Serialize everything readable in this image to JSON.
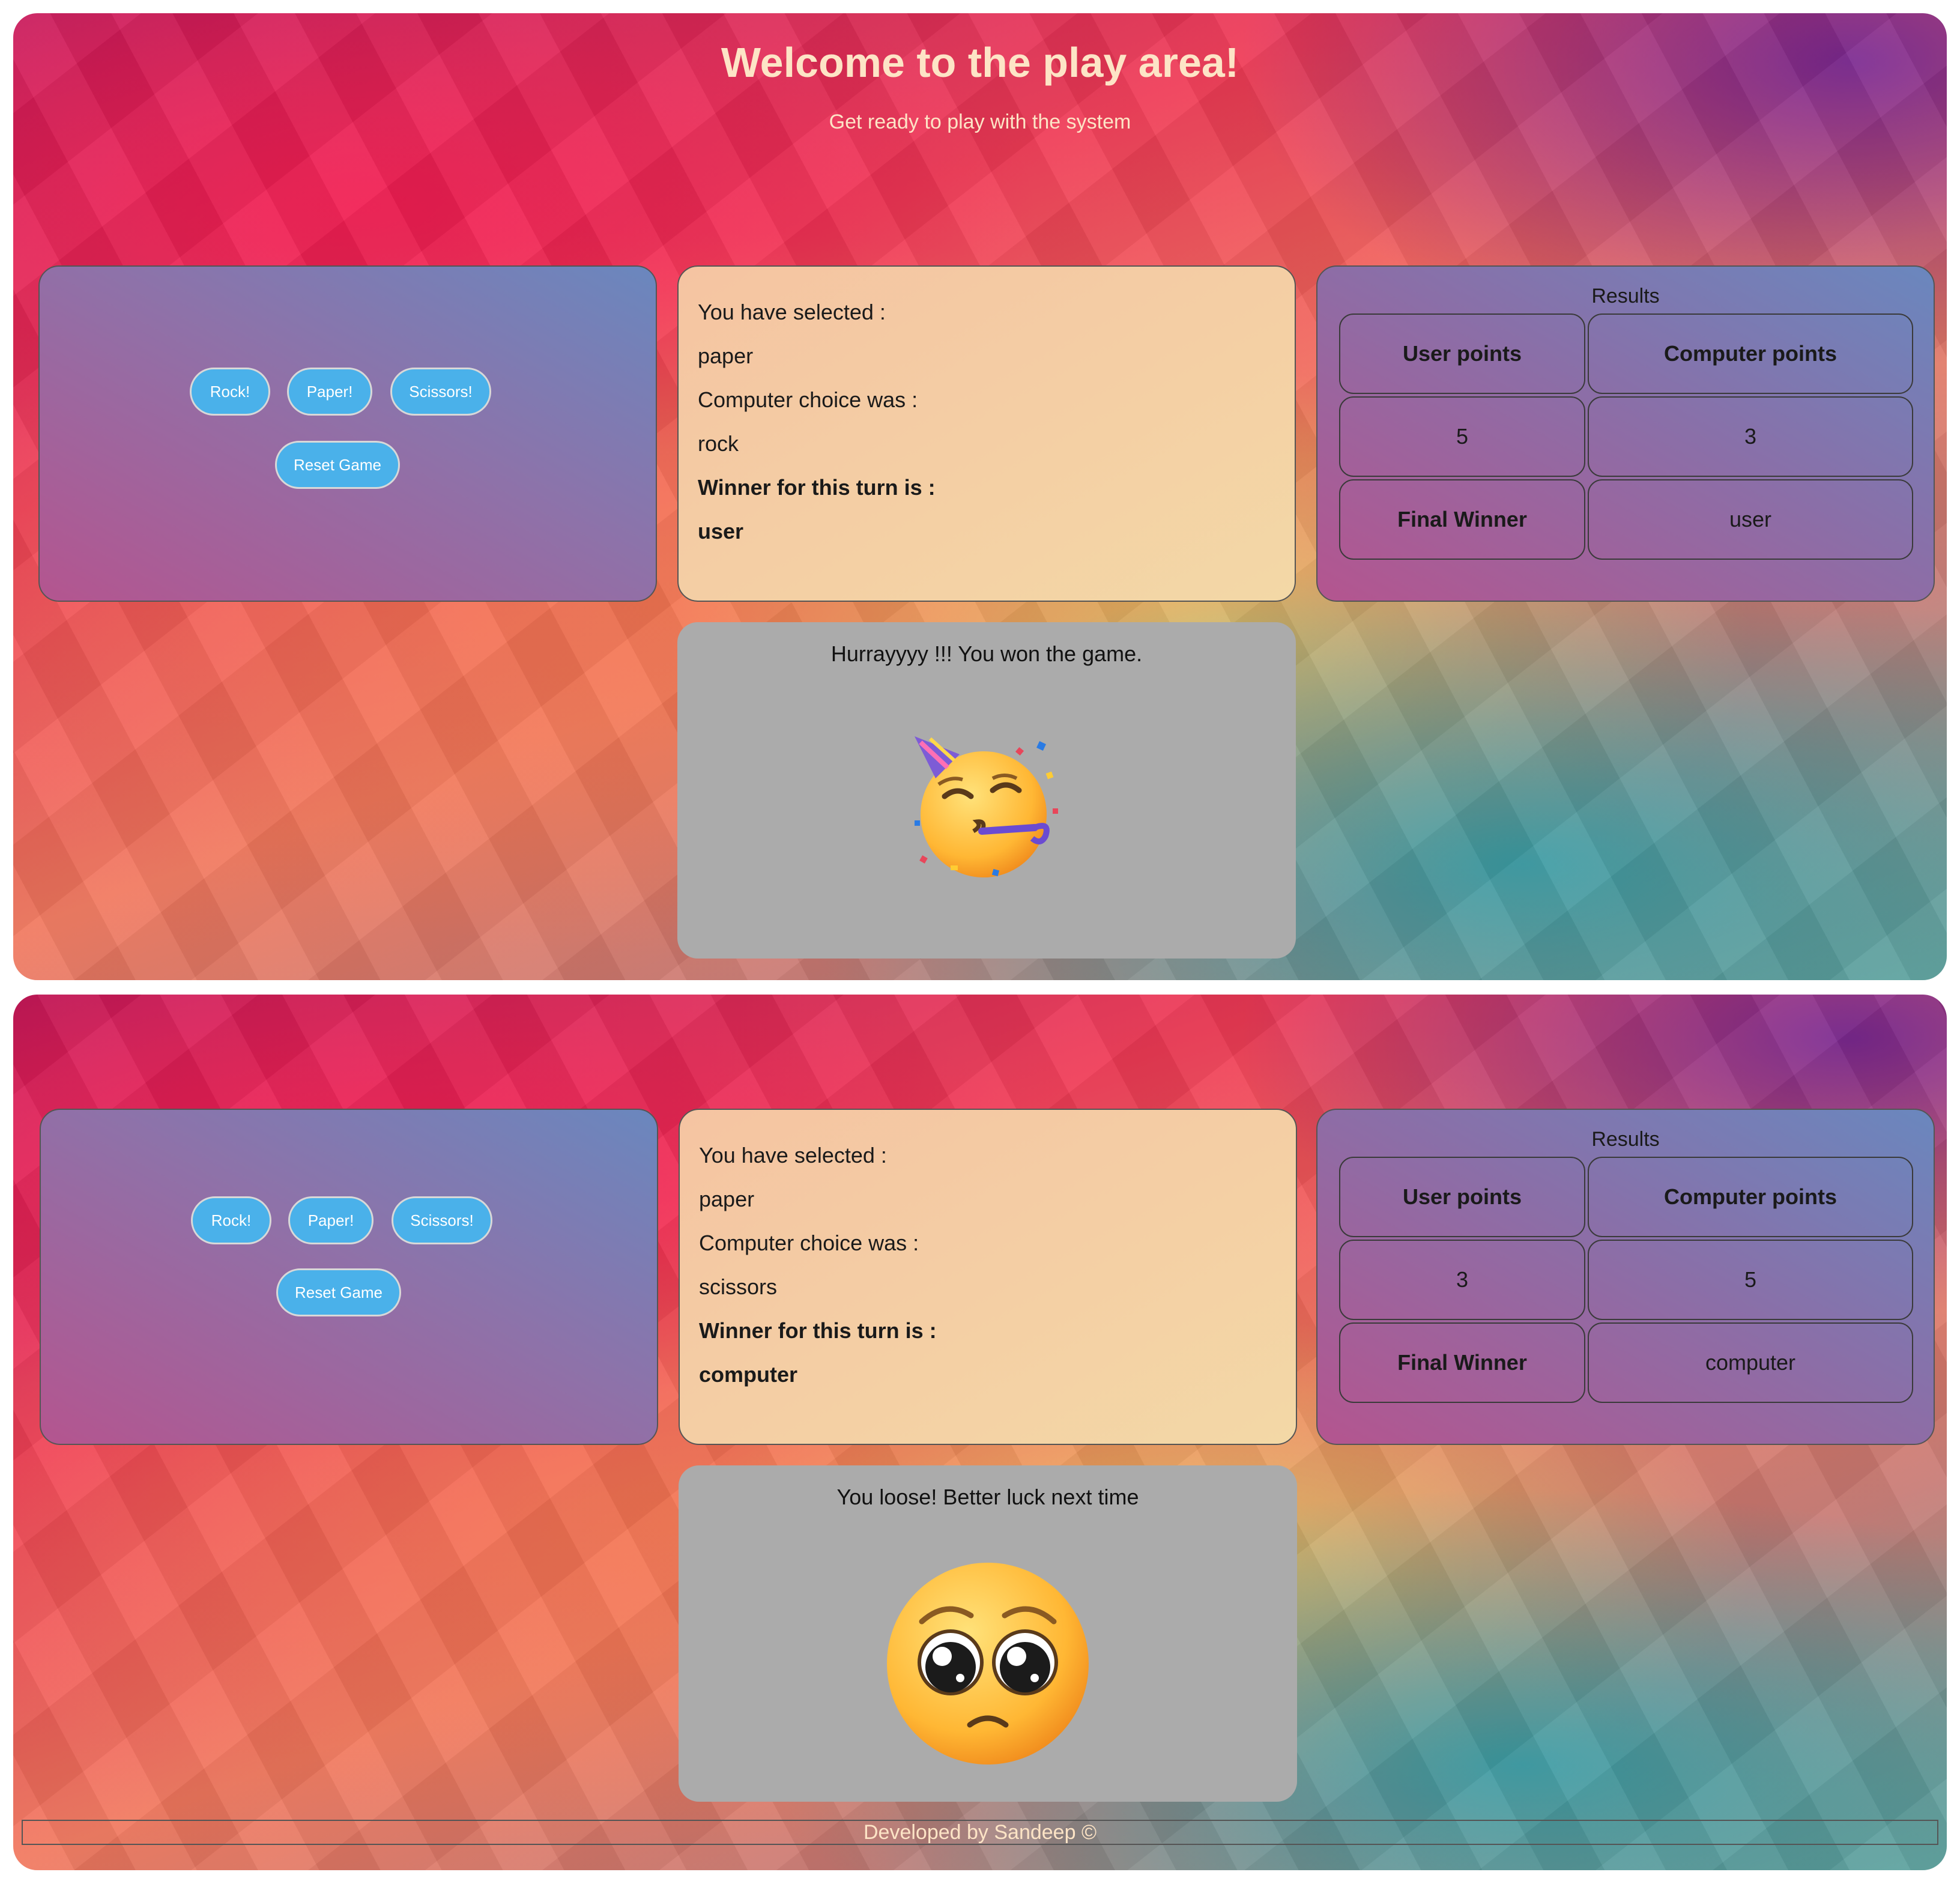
{
  "header": {
    "title": "Welcome to the play area!",
    "subtitle": "Get ready to play with the system"
  },
  "controls": {
    "rock_label": "Rock!",
    "paper_label": "Paper!",
    "scissors_label": "Scissors!",
    "reset_label": "Reset Game"
  },
  "labels": {
    "selected": "You have selected :",
    "computer_choice": "Computer choice was :",
    "turn_winner": "Winner for this turn is :",
    "results_caption": "Results",
    "user_points": "User points",
    "computer_points": "Computer points",
    "final_winner": "Final Winner"
  },
  "screens": [
    {
      "user_choice": "paper",
      "computer_choice": "rock",
      "turn_winner": "user",
      "user_score": "5",
      "computer_score": "3",
      "final_winner": "user",
      "outcome_message": "Hurrayyyy !!! You won the game.",
      "outcome_icon": "partying-face-emoji"
    },
    {
      "user_choice": "paper",
      "computer_choice": "scissors",
      "turn_winner": "computer",
      "user_score": "3",
      "computer_score": "5",
      "final_winner": "computer",
      "outcome_message": "You loose! Better luck next time",
      "outcome_icon": "pleading-face-emoji"
    }
  ],
  "footer": {
    "text": "Developed by Sandeep ©"
  },
  "colors": {
    "button": "#4ab1ea",
    "status_panel": "#f5c4a2",
    "outcome_panel": "#ababab",
    "header_text": "#fde4c6"
  }
}
